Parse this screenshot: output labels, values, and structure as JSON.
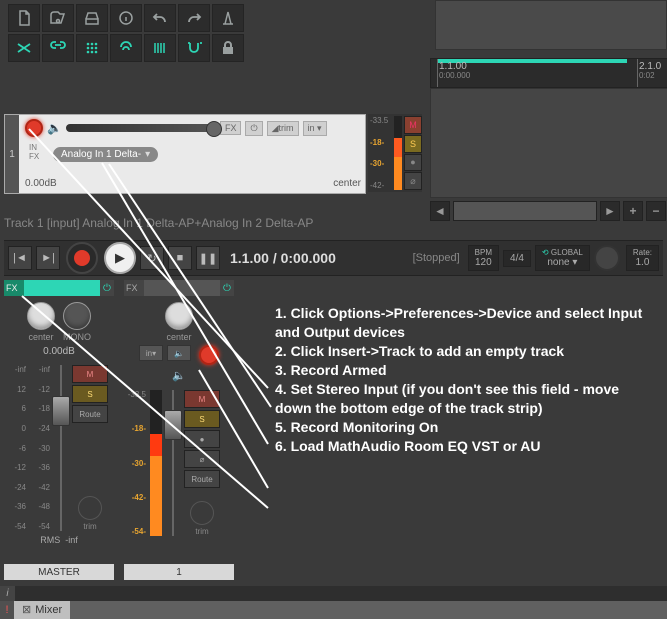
{
  "toolbar_row1": [
    "new-file",
    "open-file",
    "save-file",
    "info",
    "undo",
    "redo",
    "settings"
  ],
  "toolbar_row2": [
    "crossfade",
    "link",
    "grid",
    "ripple",
    "bars",
    "snap",
    "lock"
  ],
  "ruler": {
    "mark1": "1.1.00",
    "sub1": "0:00.000",
    "mark2": "2.1.0",
    "sub2": "0:02"
  },
  "track": {
    "num": "1",
    "input_label": "Analog In 1 Delta-",
    "in_fx": "IN\nFX",
    "fx": "FX",
    "trim": "trim",
    "in_sel": "in",
    "vol": "0.00dB",
    "pan": "center",
    "meter_marks": [
      "-33.5",
      "-18-",
      "-30-",
      "-42-"
    ],
    "btns": [
      "M",
      "S",
      "●",
      "⌀"
    ]
  },
  "status": "Track 1 [input] Analog In 1 Delta-AP+Analog In 2 Delta-AP",
  "transport": {
    "time": "1.1.00 / 0:00.000",
    "state": "[Stopped]",
    "bpm_label": "BPM",
    "bpm": "120",
    "ts": "4/4",
    "global_label": "GLOBAL",
    "global": "none",
    "rate_label": "Rate:",
    "rate": "1.0"
  },
  "mixer": {
    "master": {
      "fx": "FX",
      "pan": "center",
      "mono": "MONO",
      "db": "0.00dB",
      "scale": [
        "-inf",
        "12",
        "6",
        "0",
        "-6",
        "-12",
        "-24",
        "-36",
        "-54"
      ],
      "scale2": [
        "-inf",
        "-12",
        "-18",
        "-24",
        "-30",
        "-36",
        "-42",
        "-48",
        "-54"
      ],
      "rms": "RMS",
      "rmsv": "-inf",
      "route": "Route",
      "trim": "trim",
      "side": [
        "M",
        "S"
      ],
      "name": "MASTER"
    },
    "track1": {
      "fx": "FX",
      "pan": "center",
      "in": "in",
      "scale": [
        "-33.5",
        "-18-",
        "-30-",
        "-42-",
        "-54-"
      ],
      "route": "Route",
      "trim": "trim",
      "side": [
        "M",
        "S",
        "●",
        "⌀"
      ],
      "name": "1"
    }
  },
  "instructions": [
    "1. Click Options->Preferences->Device and select Input and Output devices",
    "2. Click Insert->Track to add an empty track",
    "3. Record Armed",
    "4. Set Stereo Input (if you don't see this field - move down the bottom edge of the track strip)",
    "5. Record Monitoring On",
    "6. Load MathAudio Room EQ VST or AU"
  ],
  "tab": "Mixer"
}
